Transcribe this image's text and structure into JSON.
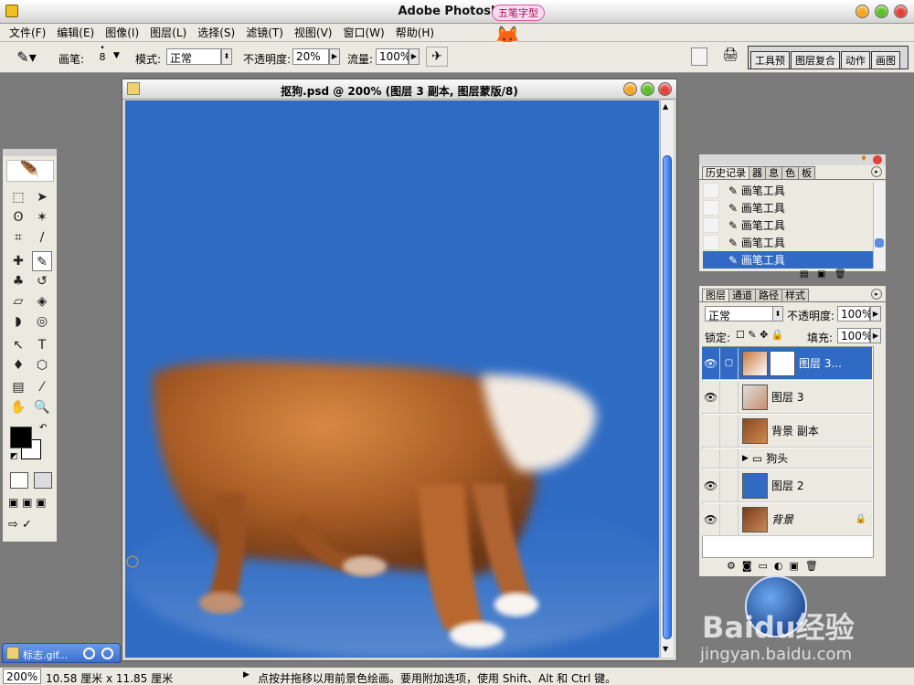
{
  "app": {
    "title": "Adobe Photoshop",
    "ime_badge": "五笔字型"
  },
  "menu": [
    "文件(F)",
    "编辑(E)",
    "图像(I)",
    "图层(L)",
    "选择(S)",
    "滤镜(T)",
    "视图(V)",
    "窗口(W)",
    "帮助(H)"
  ],
  "options": {
    "brush_label": "画笔:",
    "brush_size": "8",
    "mode_label": "模式:",
    "mode_value": "正常",
    "opacity_label": "不透明度:",
    "opacity_value": "20%",
    "flow_label": "流量:",
    "flow_value": "100%"
  },
  "palette_well_tabs": [
    "工具预",
    "图层复合",
    "动作",
    "画图"
  ],
  "document": {
    "title": "抠狗.psd @ 200% (图层 3 副本, 图层蒙版/8)"
  },
  "history_panel": {
    "tabs": [
      "历史记录",
      "器",
      "息",
      "色",
      "板"
    ],
    "items": [
      "画笔工具",
      "画笔工具",
      "画笔工具",
      "画笔工具",
      "画笔工具"
    ],
    "selected_index": 4
  },
  "layers_panel": {
    "tabs": [
      "图层",
      "通道",
      "路径",
      "样式"
    ],
    "blend_mode": "正常",
    "opacity_label": "不透明度:",
    "opacity_value": "100%",
    "lock_label": "锁定:",
    "fill_label": "填充:",
    "fill_value": "100%",
    "layers": [
      {
        "name": "图层 3...",
        "visible": true,
        "selected": true
      },
      {
        "name": "图层 3",
        "visible": true,
        "selected": false
      },
      {
        "name": "背景 副本",
        "visible": false,
        "selected": false
      },
      {
        "name": "狗头",
        "visible": false,
        "selected": false
      },
      {
        "name": "图层 2",
        "visible": true,
        "selected": false
      },
      {
        "name": "背景",
        "visible": true,
        "selected": false
      }
    ]
  },
  "status": {
    "zoom": "200%",
    "doc_size": "10.58 厘米 x 11.85 厘米",
    "hint": "点按并拖移以用前景色绘画。要用附加选项，使用 Shift、Alt 和 Ctrl 键。"
  },
  "minimized_window": "标志.gif...",
  "watermark": {
    "logo": "Baidu经验",
    "url": "jingyan.baidu.com"
  },
  "colors": {
    "canvas_bg": "#2f6bc3",
    "selection": "#316ac5",
    "foreground": "#000000",
    "background": "#ffffff"
  }
}
